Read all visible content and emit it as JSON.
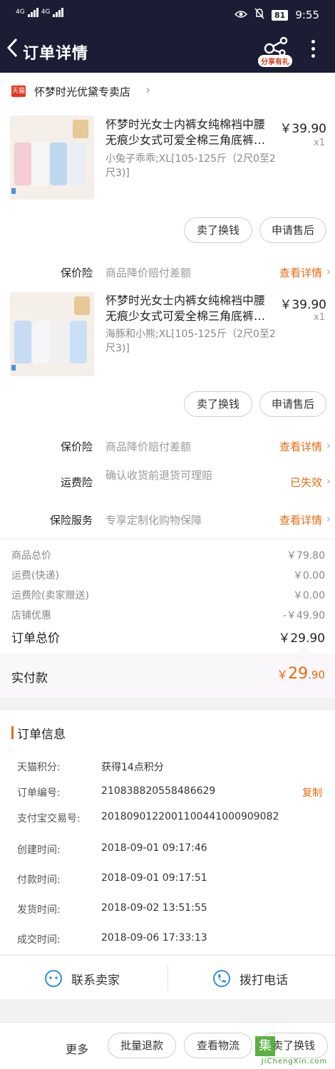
{
  "status_bar": {
    "net1": "4G",
    "net2": "4G",
    "battery": "81",
    "time": "9:55"
  },
  "nav": {
    "title": "订单详情",
    "share_badge": "分享有礼"
  },
  "shop": {
    "badge": "天猫",
    "name": "怀梦时光优黛专卖店"
  },
  "items": [
    {
      "title": "怀梦时光女士内裤女纯棉裆中腰无痕少女式可爱全棉三角底裤…",
      "sku": "小兔子乖乖;XL[105-125斤（2尺0至2尺3)]",
      "price": "￥39.90",
      "qty": "x1",
      "btn_sell": "卖了换钱",
      "btn_after": "申请售后",
      "ins_label": "保价险",
      "ins_desc": "商品降价赔付差额",
      "ins_action": "查看详情"
    },
    {
      "title": "怀梦时光女士内裤女纯棉裆中腰无痕少女式可爱全棉三角底裤…",
      "sku": "海豚和小熊;XL[105-125斤（2尺0至2尺3)]",
      "price": "￥39.90",
      "qty": "x1",
      "btn_sell": "卖了换钱",
      "btn_after": "申请售后",
      "ins_label": "保价险",
      "ins_desc": "商品降价赔付差额",
      "ins_action": "查看详情"
    }
  ],
  "extra_services": [
    {
      "label": "运费险",
      "desc": "确认收货前退货可理赔",
      "action": "已失效"
    },
    {
      "label": "保险服务",
      "desc": "专享定制化购物保障",
      "action": "查看详情"
    }
  ],
  "summary": {
    "rows": [
      {
        "k": "商品总价",
        "v": "￥79.80"
      },
      {
        "k": "运费(快递)",
        "v": "￥0.00"
      },
      {
        "k": "运费险(卖家赠送)",
        "v": "￥0.00"
      },
      {
        "k": "店铺优惠",
        "v": "-￥49.90"
      }
    ],
    "total_label": "订单总价",
    "total_value": "￥29.90",
    "paid_label": "实付款",
    "paid_currency": "￥",
    "paid_int": "29",
    "paid_dec": ".90"
  },
  "order_info": {
    "header": "订单信息",
    "copy": "复制",
    "rows": [
      {
        "k": "天猫积分:",
        "v": "获得14点积分"
      },
      {
        "k": "订单编号:",
        "v": "210838820558486629"
      },
      {
        "k": "支付宝交易号:",
        "v": "2018090122001100441000909082"
      },
      {
        "k": "创建时间:",
        "v": "2018-09-01 09:17:46"
      },
      {
        "k": "付款时间:",
        "v": "2018-09-01 09:17:51"
      },
      {
        "k": "发货时间:",
        "v": "2018-09-02 13:51:55"
      },
      {
        "k": "成交时间:",
        "v": "2018-09-06 17:33:13"
      }
    ]
  },
  "contact": {
    "seller": "联系卖家",
    "phone": "拨打电话"
  },
  "bottom_bar": {
    "more": "更多",
    "batch_refund": "批量退款",
    "logistics": "查看物流",
    "sell": "卖了换钱"
  },
  "watermark": {
    "text": "JiChengXin.com",
    "char": "集"
  },
  "colors": {
    "nav_bg": "#1a1d33",
    "accent": "#e86a10",
    "tmall_red": "#e4361e",
    "price_red": "#e86a10",
    "icon_blue": "#2d8fdc"
  }
}
